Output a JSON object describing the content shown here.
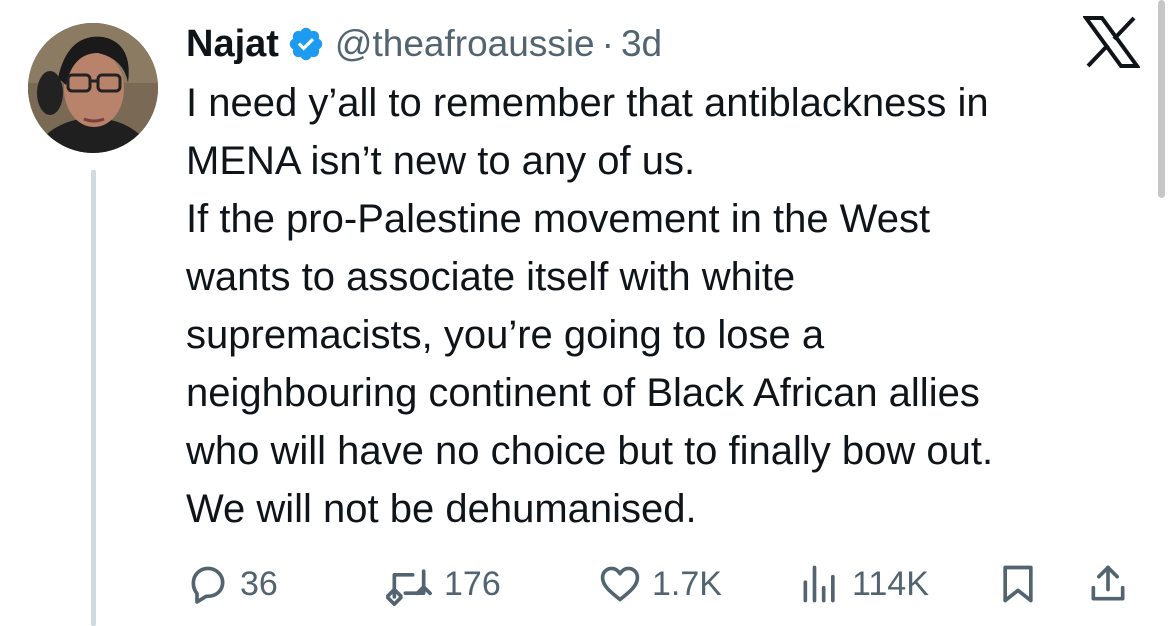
{
  "author": {
    "name": "Najat",
    "handle": "@theafroaussie",
    "separator": "·",
    "time": "3d",
    "verified_color": "#1d9bf0"
  },
  "brand_icon": "x-logo-icon",
  "tweet": {
    "lines": [
      "I need y’all to remember that antiblackness in",
      "MENA isn’t new to any of us.",
      "If the pro-Palestine movement in the West",
      "wants to associate itself with white",
      "supremacists, you’re going to lose a",
      "neighbouring continent of Black African allies",
      "who will have no choice but to finally bow out.",
      "We will not be dehumanised."
    ]
  },
  "actions": {
    "replies": {
      "icon": "reply-icon",
      "count": "36"
    },
    "retweets": {
      "icon": "retweet-icon",
      "count": "176"
    },
    "likes": {
      "icon": "heart-icon",
      "count": "1.7K"
    },
    "views": {
      "icon": "views-icon",
      "count": "114K"
    },
    "bookmark": {
      "icon": "bookmark-icon"
    },
    "share": {
      "icon": "share-icon"
    }
  },
  "colors": {
    "text": "#0f1419",
    "secondary": "#536471",
    "thread_line": "#cfd9de"
  }
}
